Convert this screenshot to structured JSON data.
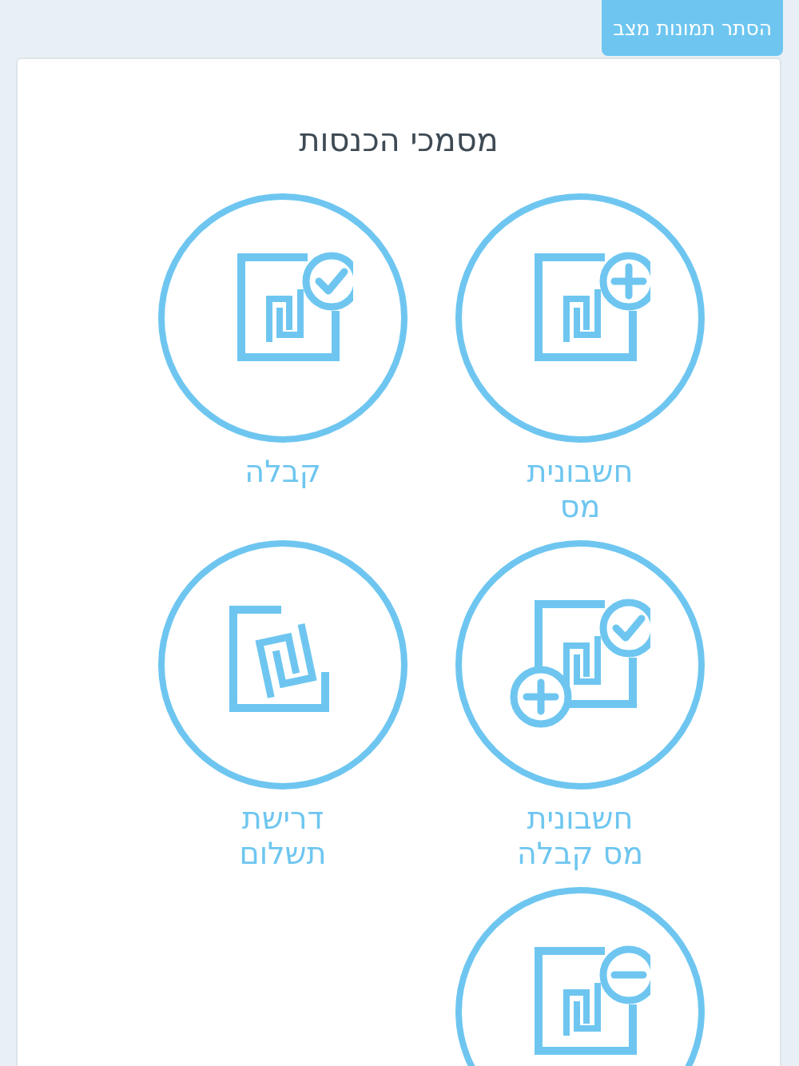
{
  "toggle_button": {
    "label": "הסתר תמונות מצב"
  },
  "card": {
    "title": "מסמכי הכנסות",
    "documents": [
      {
        "kind": "plus",
        "label": "חשבונית מס"
      },
      {
        "kind": "check",
        "label": "קבלה"
      },
      {
        "kind": "plus-check",
        "label": "חשבונית מס קבלה"
      },
      {
        "kind": "tilted",
        "label": "דרישת תשלום"
      },
      {
        "kind": "minus"
      }
    ]
  }
}
